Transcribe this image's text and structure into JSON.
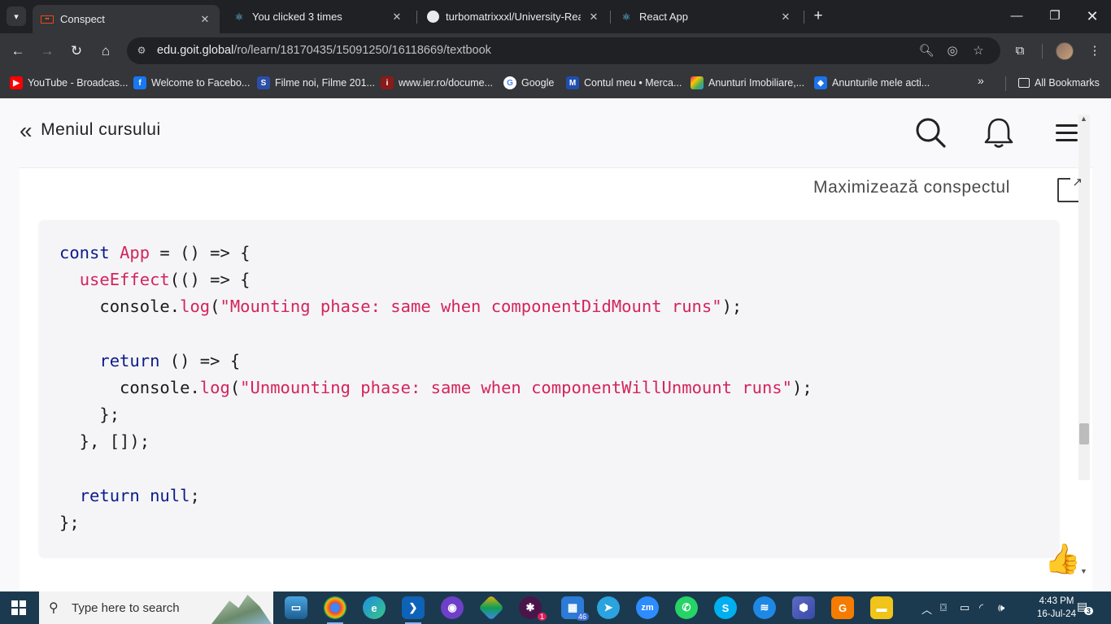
{
  "browser": {
    "tabs": [
      {
        "title": "Conspect",
        "active": true,
        "icon": "goit-favicon"
      },
      {
        "title": "You clicked 3 times",
        "active": false,
        "icon": "react-favicon"
      },
      {
        "title": "turbomatrixxxl/University-React",
        "active": false,
        "icon": "github-favicon"
      },
      {
        "title": "React App",
        "active": false,
        "icon": "react-favicon"
      }
    ],
    "url_host": "edu.goit.global",
    "url_path": "/ro/learn/18170435/15091250/16118669/textbook",
    "bookmarks": [
      {
        "label": "YouTube - Broadcas...",
        "color": "#ff0000",
        "glyph": "▶"
      },
      {
        "label": "Welcome to Facebo...",
        "color": "#1877f2",
        "glyph": "f"
      },
      {
        "label": "Filme noi, Filme 201...",
        "color": "#2b4ea8",
        "glyph": "S"
      },
      {
        "label": "www.ier.ro/docume...",
        "color": "#8b1a1a",
        "glyph": "i"
      },
      {
        "label": "Google",
        "color": "#4285f4",
        "glyph": "G"
      },
      {
        "label": "Contul meu • Merca...",
        "color": "#1e4fae",
        "glyph": "M"
      },
      {
        "label": "Anunturi Imobiliare,...",
        "color": "#9c27b0",
        "glyph": "▦"
      },
      {
        "label": "Anunturile mele acti...",
        "color": "#1a73e8",
        "glyph": "◆"
      }
    ],
    "all_bookmarks": "All Bookmarks"
  },
  "page": {
    "back_label": "Meniul cursului",
    "maximize_label": "Maximizează conspectul"
  },
  "code_lines": [
    [
      {
        "t": "const ",
        "c": "kw"
      },
      {
        "t": "App",
        "c": "fn"
      },
      {
        "t": " = () => {",
        "c": ""
      }
    ],
    [
      {
        "t": "  ",
        "c": ""
      },
      {
        "t": "useEffect",
        "c": "fn"
      },
      {
        "t": "(() => {",
        "c": ""
      }
    ],
    [
      {
        "t": "    console.",
        "c": ""
      },
      {
        "t": "log",
        "c": "fn"
      },
      {
        "t": "(",
        "c": ""
      },
      {
        "t": "\"Mounting phase: same when componentDidMount runs\"",
        "c": "str"
      },
      {
        "t": ");",
        "c": ""
      }
    ],
    [
      {
        "t": "",
        "c": ""
      }
    ],
    [
      {
        "t": "    ",
        "c": ""
      },
      {
        "t": "return",
        "c": "kw"
      },
      {
        "t": " () => {",
        "c": ""
      }
    ],
    [
      {
        "t": "      console.",
        "c": ""
      },
      {
        "t": "log",
        "c": "fn"
      },
      {
        "t": "(",
        "c": ""
      },
      {
        "t": "\"Unmounting phase: same when componentWillUnmount runs\"",
        "c": "str"
      },
      {
        "t": ");",
        "c": ""
      }
    ],
    [
      {
        "t": "    };",
        "c": ""
      }
    ],
    [
      {
        "t": "  }, []);",
        "c": ""
      }
    ],
    [
      {
        "t": "",
        "c": ""
      }
    ],
    [
      {
        "t": "  ",
        "c": ""
      },
      {
        "t": "return null",
        "c": "kw"
      },
      {
        "t": ";",
        "c": ""
      }
    ],
    [
      {
        "t": "};",
        "c": ""
      }
    ]
  ],
  "taskbar": {
    "search_placeholder": "Type here to search",
    "time": "4:43 PM",
    "date": "16-Jul-24",
    "notification_count": "3",
    "telegram_badge": "46",
    "slack_badge": "1"
  }
}
